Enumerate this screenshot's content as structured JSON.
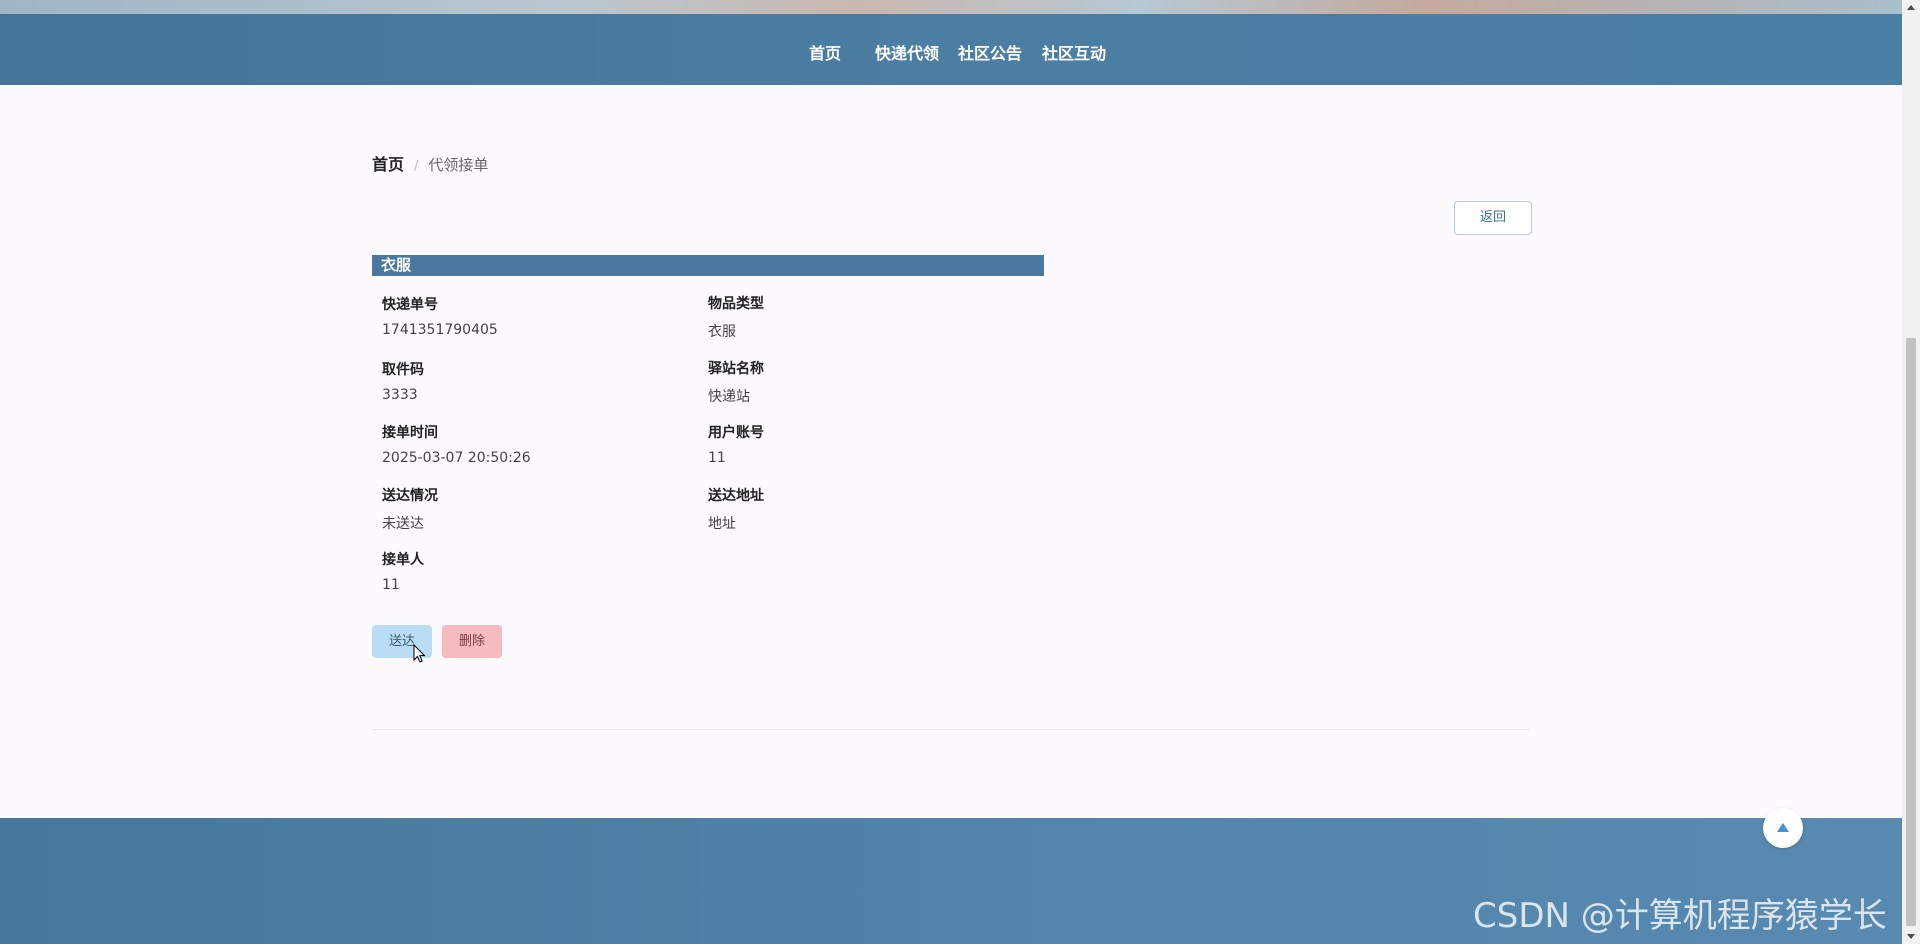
{
  "nav": {
    "home": "首页",
    "express": "快递代领",
    "notice": "社区公告",
    "forum": "社区互动"
  },
  "breadcrumb": {
    "home": "首页",
    "separator": "/",
    "current": "代领接单"
  },
  "back_button": "返回",
  "section_title": "衣服",
  "fields": [
    {
      "label": "快递单号",
      "value": "1741351790405"
    },
    {
      "label": "物品类型",
      "value": "衣服"
    },
    {
      "label": "取件码",
      "value": "3333"
    },
    {
      "label": "驿站名称",
      "value": "快递站"
    },
    {
      "label": "接单时间",
      "value": "2025-03-07 20:50:26"
    },
    {
      "label": "用户账号",
      "value": "11"
    },
    {
      "label": "送达情况",
      "value": "未送达"
    },
    {
      "label": "送达地址",
      "value": "地址"
    },
    {
      "label": "接单人",
      "value": "11"
    }
  ],
  "actions": {
    "deliver": "送达",
    "delete": "删除"
  },
  "watermark": "CSDN @计算机程序猿学长",
  "colors": {
    "nav_bg": "#4a7ca2",
    "section_bar": "#4a78a0",
    "deliver_btn": "#b9ddf5",
    "delete_btn": "#f6babf"
  }
}
